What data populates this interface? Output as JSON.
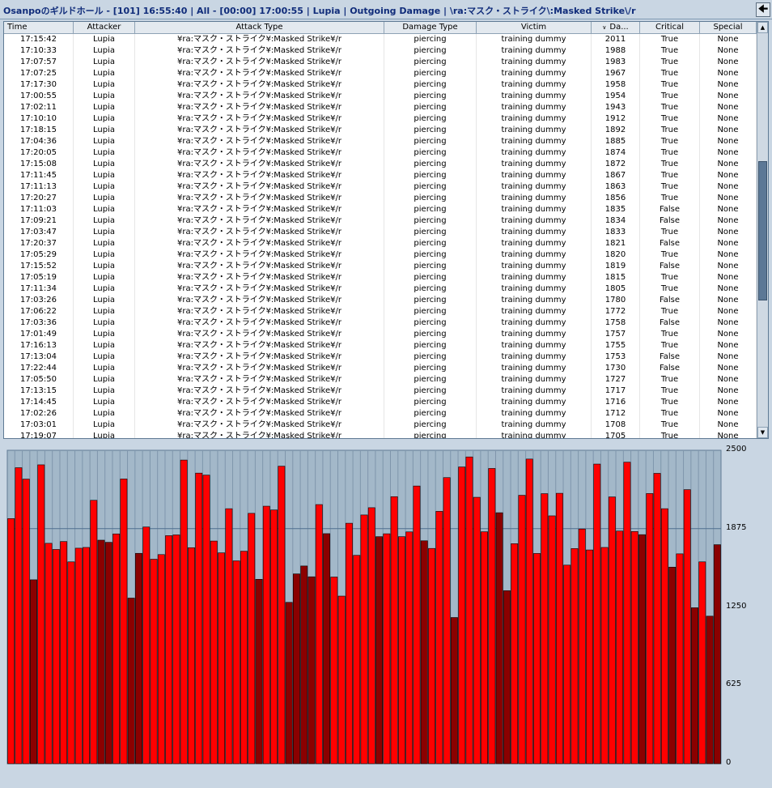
{
  "window": {
    "title": "Osanpoのギルドホール - [101] 16:55:40  | All - [00:00] 17:00:55  | Lupia  |  Outgoing Damage  | \\ra:マスク・ストライク\\:Masked Strike\\/r",
    "back_icon": "arrow-left-icon"
  },
  "table": {
    "columns": [
      "Time",
      "Attacker",
      "Attack Type",
      "Damage Type",
      "Victim",
      "Da...",
      "Critical",
      "Special"
    ],
    "sorted_column": "Da...",
    "sort_direction": "descending",
    "attack_type_text": "¥ra:マスク・ストライク¥:Masked Strike¥/r",
    "rows": [
      [
        "17:15:42",
        "Lupia",
        "¥ra:マスク・ストライク¥:Masked Strike¥/r",
        "piercing",
        "training dummy",
        "2011",
        "True",
        "None"
      ],
      [
        "17:10:33",
        "Lupia",
        "¥ra:マスク・ストライク¥:Masked Strike¥/r",
        "piercing",
        "training dummy",
        "1988",
        "True",
        "None"
      ],
      [
        "17:07:57",
        "Lupia",
        "¥ra:マスク・ストライク¥:Masked Strike¥/r",
        "piercing",
        "training dummy",
        "1983",
        "True",
        "None"
      ],
      [
        "17:07:25",
        "Lupia",
        "¥ra:マスク・ストライク¥:Masked Strike¥/r",
        "piercing",
        "training dummy",
        "1967",
        "True",
        "None"
      ],
      [
        "17:17:30",
        "Lupia",
        "¥ra:マスク・ストライク¥:Masked Strike¥/r",
        "piercing",
        "training dummy",
        "1958",
        "True",
        "None"
      ],
      [
        "17:00:55",
        "Lupia",
        "¥ra:マスク・ストライク¥:Masked Strike¥/r",
        "piercing",
        "training dummy",
        "1954",
        "True",
        "None"
      ],
      [
        "17:02:11",
        "Lupia",
        "¥ra:マスク・ストライク¥:Masked Strike¥/r",
        "piercing",
        "training dummy",
        "1943",
        "True",
        "None"
      ],
      [
        "17:10:10",
        "Lupia",
        "¥ra:マスク・ストライク¥:Masked Strike¥/r",
        "piercing",
        "training dummy",
        "1912",
        "True",
        "None"
      ],
      [
        "17:18:15",
        "Lupia",
        "¥ra:マスク・ストライク¥:Masked Strike¥/r",
        "piercing",
        "training dummy",
        "1892",
        "True",
        "None"
      ],
      [
        "17:04:36",
        "Lupia",
        "¥ra:マスク・ストライク¥:Masked Strike¥/r",
        "piercing",
        "training dummy",
        "1885",
        "True",
        "None"
      ],
      [
        "17:20:05",
        "Lupia",
        "¥ra:マスク・ストライク¥:Masked Strike¥/r",
        "piercing",
        "training dummy",
        "1874",
        "True",
        "None"
      ],
      [
        "17:15:08",
        "Lupia",
        "¥ra:マスク・ストライク¥:Masked Strike¥/r",
        "piercing",
        "training dummy",
        "1872",
        "True",
        "None"
      ],
      [
        "17:11:45",
        "Lupia",
        "¥ra:マスク・ストライク¥:Masked Strike¥/r",
        "piercing",
        "training dummy",
        "1867",
        "True",
        "None"
      ],
      [
        "17:11:13",
        "Lupia",
        "¥ra:マスク・ストライク¥:Masked Strike¥/r",
        "piercing",
        "training dummy",
        "1863",
        "True",
        "None"
      ],
      [
        "17:20:27",
        "Lupia",
        "¥ra:マスク・ストライク¥:Masked Strike¥/r",
        "piercing",
        "training dummy",
        "1856",
        "True",
        "None"
      ],
      [
        "17:11:03",
        "Lupia",
        "¥ra:マスク・ストライク¥:Masked Strike¥/r",
        "piercing",
        "training dummy",
        "1835",
        "False",
        "None"
      ],
      [
        "17:09:21",
        "Lupia",
        "¥ra:マスク・ストライク¥:Masked Strike¥/r",
        "piercing",
        "training dummy",
        "1834",
        "False",
        "None"
      ],
      [
        "17:03:47",
        "Lupia",
        "¥ra:マスク・ストライク¥:Masked Strike¥/r",
        "piercing",
        "training dummy",
        "1833",
        "True",
        "None"
      ],
      [
        "17:20:37",
        "Lupia",
        "¥ra:マスク・ストライク¥:Masked Strike¥/r",
        "piercing",
        "training dummy",
        "1821",
        "False",
        "None"
      ],
      [
        "17:05:29",
        "Lupia",
        "¥ra:マスク・ストライク¥:Masked Strike¥/r",
        "piercing",
        "training dummy",
        "1820",
        "True",
        "None"
      ],
      [
        "17:15:52",
        "Lupia",
        "¥ra:マスク・ストライク¥:Masked Strike¥/r",
        "piercing",
        "training dummy",
        "1819",
        "False",
        "None"
      ],
      [
        "17:05:19",
        "Lupia",
        "¥ra:マスク・ストライク¥:Masked Strike¥/r",
        "piercing",
        "training dummy",
        "1815",
        "True",
        "None"
      ],
      [
        "17:11:34",
        "Lupia",
        "¥ra:マスク・ストライク¥:Masked Strike¥/r",
        "piercing",
        "training dummy",
        "1805",
        "True",
        "None"
      ],
      [
        "17:03:26",
        "Lupia",
        "¥ra:マスク・ストライク¥:Masked Strike¥/r",
        "piercing",
        "training dummy",
        "1780",
        "False",
        "None"
      ],
      [
        "17:06:22",
        "Lupia",
        "¥ra:マスク・ストライク¥:Masked Strike¥/r",
        "piercing",
        "training dummy",
        "1772",
        "True",
        "None"
      ],
      [
        "17:03:36",
        "Lupia",
        "¥ra:マスク・ストライク¥:Masked Strike¥/r",
        "piercing",
        "training dummy",
        "1758",
        "False",
        "None"
      ],
      [
        "17:01:49",
        "Lupia",
        "¥ra:マスク・ストライク¥:Masked Strike¥/r",
        "piercing",
        "training dummy",
        "1757",
        "True",
        "None"
      ],
      [
        "17:16:13",
        "Lupia",
        "¥ra:マスク・ストライク¥:Masked Strike¥/r",
        "piercing",
        "training dummy",
        "1755",
        "True",
        "None"
      ],
      [
        "17:13:04",
        "Lupia",
        "¥ra:マスク・ストライク¥:Masked Strike¥/r",
        "piercing",
        "training dummy",
        "1753",
        "False",
        "None"
      ],
      [
        "17:22:44",
        "Lupia",
        "¥ra:マスク・ストライク¥:Masked Strike¥/r",
        "piercing",
        "training dummy",
        "1730",
        "False",
        "None"
      ],
      [
        "17:05:50",
        "Lupia",
        "¥ra:マスク・ストライク¥:Masked Strike¥/r",
        "piercing",
        "training dummy",
        "1727",
        "True",
        "None"
      ],
      [
        "17:13:15",
        "Lupia",
        "¥ra:マスク・ストライク¥:Masked Strike¥/r",
        "piercing",
        "training dummy",
        "1717",
        "True",
        "None"
      ],
      [
        "17:14:45",
        "Lupia",
        "¥ra:マスク・ストライク¥:Masked Strike¥/r",
        "piercing",
        "training dummy",
        "1716",
        "True",
        "None"
      ],
      [
        "17:02:26",
        "Lupia",
        "¥ra:マスク・ストライク¥:Masked Strike¥/r",
        "piercing",
        "training dummy",
        "1712",
        "True",
        "None"
      ],
      [
        "17:03:01",
        "Lupia",
        "¥ra:マスク・ストライク¥:Masked Strike¥/r",
        "piercing",
        "training dummy",
        "1708",
        "True",
        "None"
      ],
      [
        "17:19:07",
        "Lupia",
        "¥ra:マスク・ストライク¥:Masked Strike¥/r",
        "piercing",
        "training dummy",
        "1705",
        "True",
        "None"
      ]
    ]
  },
  "chart_data": {
    "type": "bar",
    "y_tick_labels": [
      "2500",
      "1875",
      "1250",
      "625",
      "0"
    ],
    "ylim": [
      0,
      2500
    ],
    "grid": true,
    "reference_line": 1875,
    "colors": {
      "normal": "#ff0000",
      "critical": "#8b0000",
      "background": "#a3b8c9",
      "gridline": "#7f96ac"
    },
    "values": [
      1955,
      2361,
      2270,
      1467,
      2384,
      1758,
      1709,
      1772,
      1610,
      1719,
      1725,
      2101,
      1783,
      1766,
      1833,
      2271,
      1321,
      1678,
      1888,
      1631,
      1668,
      1819,
      1825,
      2422,
      1723,
      2318,
      2302,
      1776,
      1682,
      2034,
      1618,
      1695,
      1997,
      1471,
      2054,
      2024,
      2373,
      1287,
      1514,
      1577,
      1491,
      2067,
      1835,
      1489,
      1337,
      1918,
      1662,
      1984,
      2042,
      1811,
      1834,
      2130,
      1811,
      1849,
      2215,
      1778,
      1717,
      2013,
      2282,
      1166,
      2367,
      2447,
      2125,
      1850,
      2355,
      2002,
      1380,
      1755,
      2141,
      2430,
      1677,
      2154,
      1977,
      2157,
      1584,
      1716,
      1872,
      1705,
      2390,
      1725,
      2128,
      1856,
      2405,
      1852,
      1827,
      2155,
      2316,
      2034,
      1568,
      1674,
      2186,
      1244,
      1610,
      1177,
      1747
    ],
    "critical": [
      0,
      0,
      0,
      1,
      0,
      0,
      0,
      0,
      0,
      0,
      0,
      0,
      1,
      1,
      0,
      0,
      1,
      1,
      0,
      0,
      0,
      0,
      0,
      0,
      0,
      0,
      0,
      0,
      0,
      0,
      0,
      0,
      0,
      1,
      0,
      0,
      0,
      1,
      1,
      1,
      1,
      0,
      1,
      0,
      0,
      0,
      0,
      0,
      0,
      1,
      0,
      0,
      0,
      0,
      0,
      1,
      0,
      0,
      0,
      1,
      0,
      0,
      0,
      0,
      0,
      1,
      1,
      0,
      0,
      0,
      0,
      0,
      0,
      0,
      0,
      0,
      0,
      0,
      0,
      0,
      0,
      0,
      0,
      0,
      1,
      0,
      0,
      0,
      1,
      0,
      0,
      1,
      0,
      1,
      1
    ]
  }
}
